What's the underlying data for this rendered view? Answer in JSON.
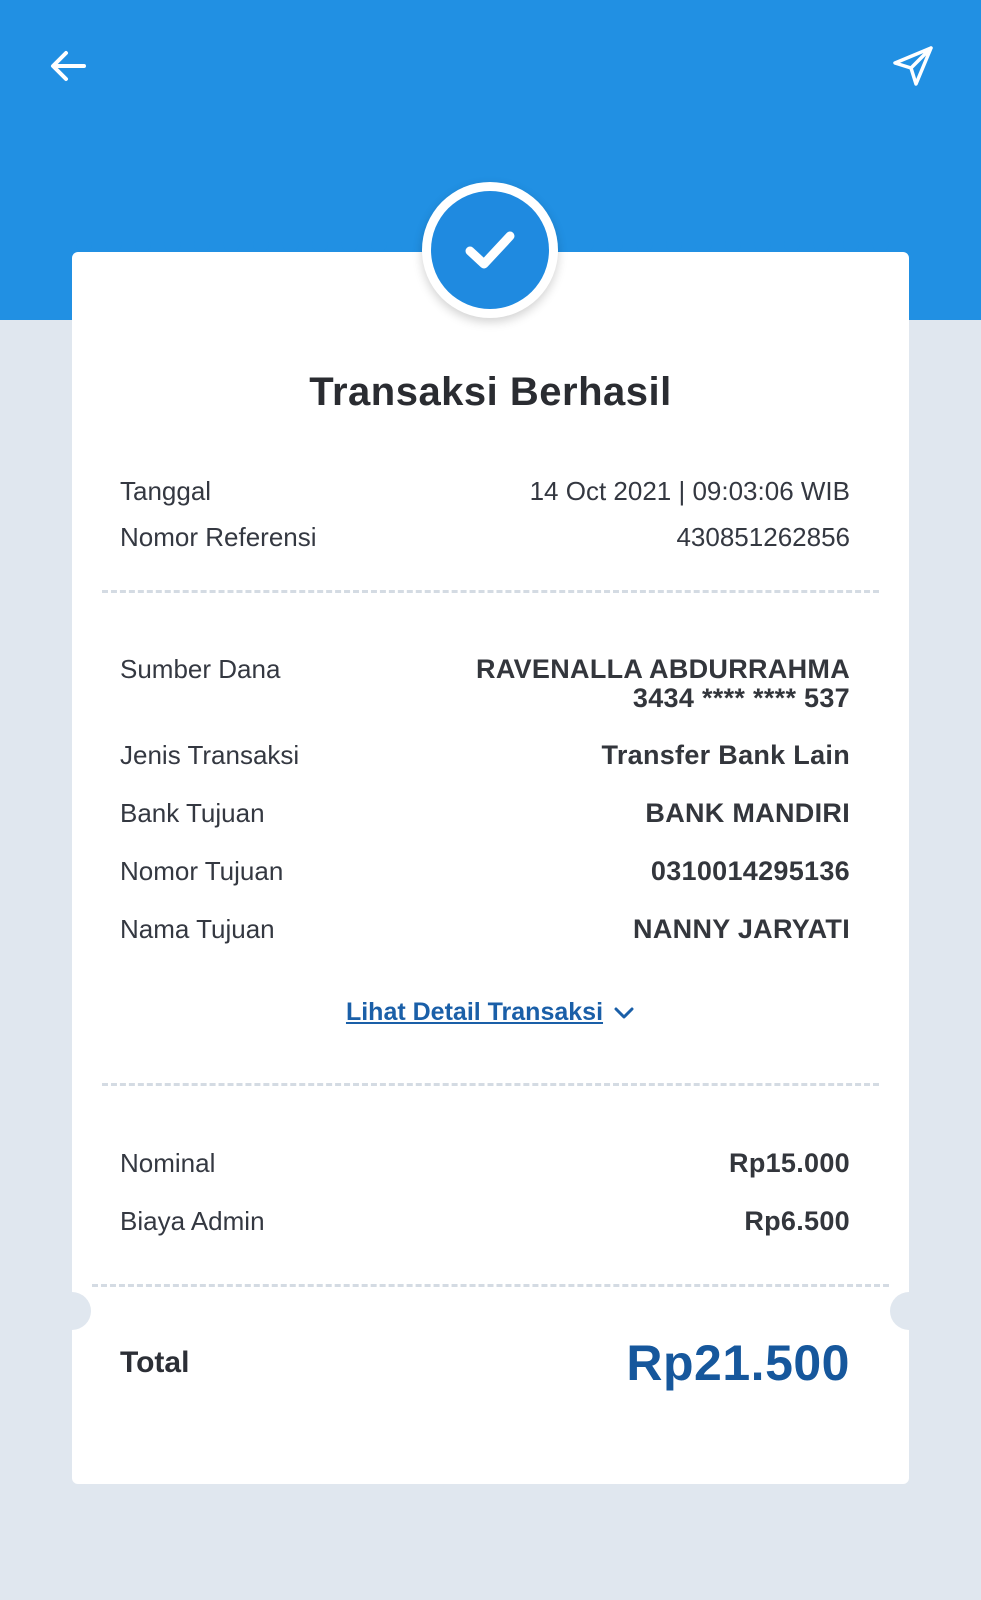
{
  "header": {
    "back_icon": "arrow-left-icon",
    "share_icon": "send-icon",
    "bg_color": "#2190e3"
  },
  "receipt": {
    "status_icon": "check-circle-icon",
    "title": "Transaksi Berhasil",
    "date_label": "Tanggal",
    "date_value": "14 Oct 2021 | 09:03:06 WIB",
    "ref_label": "Nomor Referensi",
    "ref_value": "430851262856",
    "source_label": "Sumber Dana",
    "source_name": "RAVENALLA ABDURRAHMA",
    "source_account": "3434 **** **** 537",
    "type_label": "Jenis Transaksi",
    "type_value": "Transfer Bank Lain",
    "bank_label": "Bank Tujuan",
    "bank_value": "BANK MANDIRI",
    "dest_number_label": "Nomor Tujuan",
    "dest_number_value": "0310014295136",
    "dest_name_label": "Nama Tujuan",
    "dest_name_value": "NANNY JARYATI",
    "detail_link": "Lihat Detail Transaksi",
    "nominal_label": "Nominal",
    "nominal_value": "Rp15.000",
    "admin_label": "Biaya Admin",
    "admin_value": "Rp6.500",
    "total_label": "Total",
    "total_value": "Rp21.500",
    "total_color": "#16579c",
    "link_color": "#1a5fa8"
  }
}
